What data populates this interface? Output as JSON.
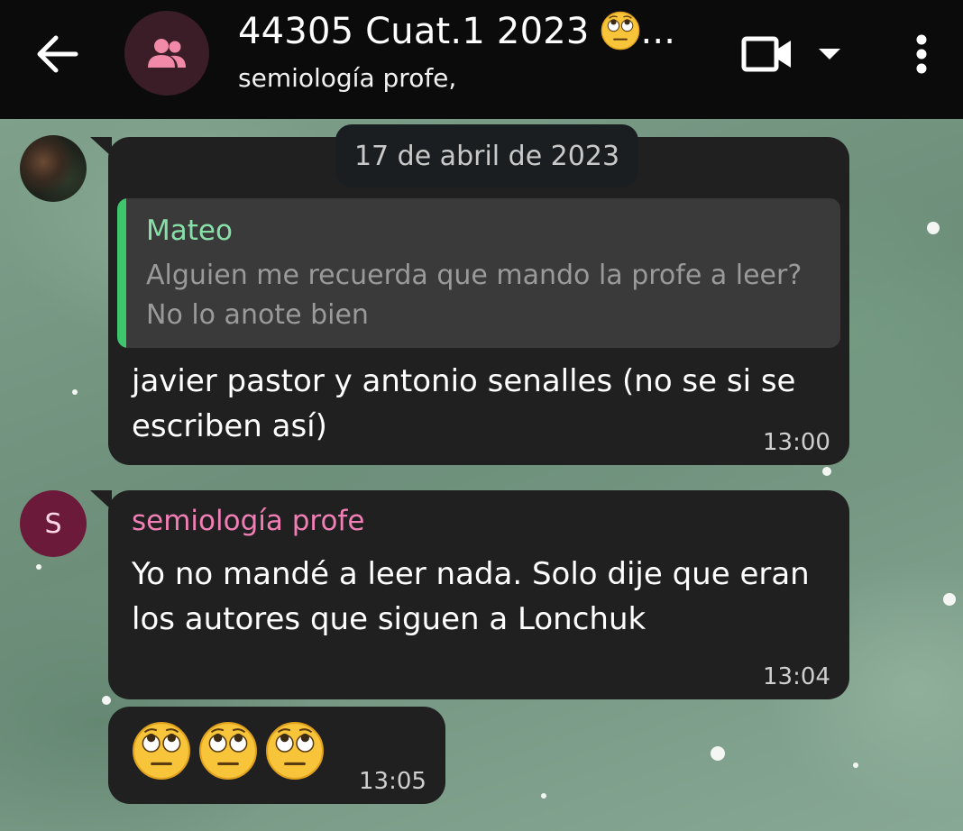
{
  "header": {
    "title": "44305 Cuat.1 2023",
    "title_suffix": "...",
    "subtitle": "semiología profe,",
    "back_icon": "arrow-left-icon",
    "group_icon": "group-icon",
    "video_icon": "video-camera-icon",
    "dropdown_icon": "caret-down-icon",
    "menu_icon": "more-vert-icon"
  },
  "chat": {
    "date_label": "17 de abril de 2023",
    "messages": [
      {
        "reply": {
          "sender": "Mateo",
          "text": "Alguien me recuerda que mando la profe a leer? No lo anote bien"
        },
        "text": "javier pastor y antonio senalles (no se si se escriben así)",
        "time": "13:00"
      },
      {
        "sender": "semiología profe",
        "avatar_letter": "S",
        "text": "Yo no mandé a leer nada. Solo dije que eran los autores que siguen a Lonchuk",
        "time": "13:04"
      },
      {
        "emoji_count": 3,
        "emoji_name": "face-with-rolling-eyes",
        "time": "13:05"
      }
    ]
  },
  "colors": {
    "header_bg": "#0b0b0b",
    "bubble_bg": "#202020",
    "reply_bar": "#3ec66c",
    "reply_sender": "#88e0a8",
    "sender_name": "#f07fb5",
    "avatar_s_bg": "#6b1a3a"
  }
}
